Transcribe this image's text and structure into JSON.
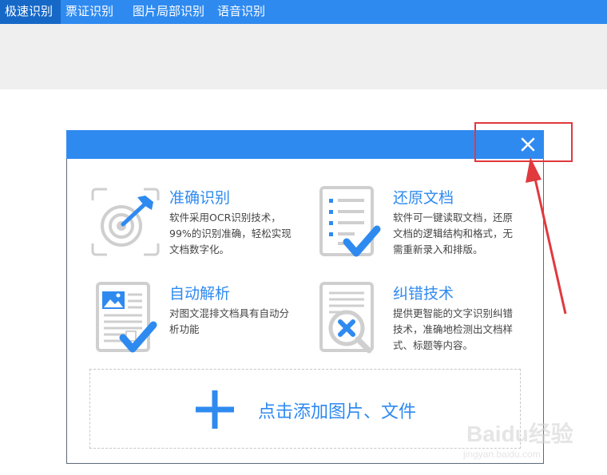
{
  "tabs": [
    {
      "label": "极速识别",
      "active": true
    },
    {
      "label": "票证识别",
      "active": false
    },
    {
      "label": "图片局部识别",
      "active": false
    },
    {
      "label": "语音识别",
      "active": false
    }
  ],
  "dialog": {
    "close_icon": "close-icon",
    "features": [
      {
        "title": "准确识别",
        "desc": "软件采用OCR识别技术，99%的识别准确，轻松实现文档数字化。",
        "icon": "target-icon"
      },
      {
        "title": "还原文档",
        "desc": "软件可一键读取文档，还原文档的逻辑结构和格式，无需重新录入和排版。",
        "icon": "document-check-icon"
      },
      {
        "title": "自动解析",
        "desc": "对图文混排文档具有自动分析功能",
        "icon": "image-document-icon"
      },
      {
        "title": "纠错技术",
        "desc": "提供更智能的文字识别纠错技术，准确地检测出文档样式、标题等内容。",
        "icon": "magnifier-x-icon"
      }
    ],
    "upload_label": "点击添加图片、文件"
  },
  "colors": {
    "accent": "#2f8af0",
    "tab_active": "#1668c7",
    "annotation": "#e0393e"
  },
  "watermark": {
    "brand": "Baidu经验",
    "url": "jingyan.baidu.com"
  }
}
